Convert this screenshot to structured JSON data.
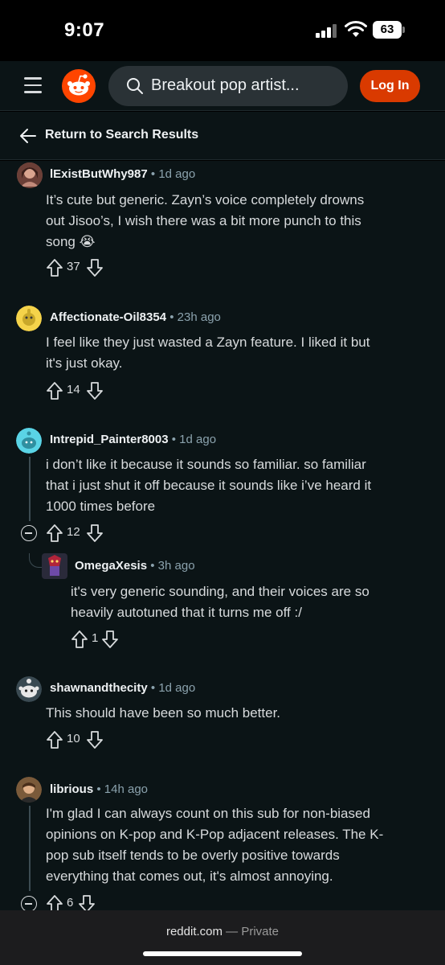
{
  "status_bar": {
    "time": "9:07",
    "battery": "63"
  },
  "header": {
    "search_text": "Breakout pop artist...",
    "login_label": "Log In"
  },
  "nav": {
    "return_label": "Return to Search Results"
  },
  "comments": [
    {
      "username": "lExistButWhy987",
      "age": "1d ago",
      "lines": [
        "It’s cute but generic. Zayn’s voice completely drowns",
        "out Jisoo’s, I wish there was a bit more punch to this",
        "song 😭"
      ],
      "score": "37"
    },
    {
      "username": "Affectionate-Oil8354",
      "age": "23h ago",
      "lines": [
        "I feel like they just wasted a Zayn feature. I liked it but",
        "it's just okay."
      ],
      "score": "14"
    },
    {
      "username": "Intrepid_Painter8003",
      "age": "1d ago",
      "lines": [
        "i don’t like it because it sounds so familiar. so familiar",
        "that i just shut it off because it sounds like i’ve heard it",
        "1000 times before"
      ],
      "score": "12"
    },
    {
      "username": "OmegaXesis",
      "age": "3h ago",
      "lines": [
        "it's very generic sounding, and their voices are so",
        "heavily autotuned that it turns me off :/"
      ],
      "score": "1"
    },
    {
      "username": "shawnandthecity",
      "age": "1d ago",
      "lines": [
        "This should have been so much better."
      ],
      "score": "10"
    },
    {
      "username": "librious",
      "age": "14h ago",
      "lines": [
        "I'm glad I can always count on this sub for non-biased",
        "opinions on K-pop and K-Pop adjacent releases. The K-",
        "pop sub itself tends to be overly positive towards",
        "everything that comes out, it's almost annoying."
      ],
      "score": "6"
    }
  ],
  "separator": "•",
  "footer": {
    "domain": "reddit.com",
    "private_label": "— Private"
  },
  "colors": {
    "accent": "#d93a00",
    "background": "#0b1416",
    "muted": "#8ba2ad"
  }
}
